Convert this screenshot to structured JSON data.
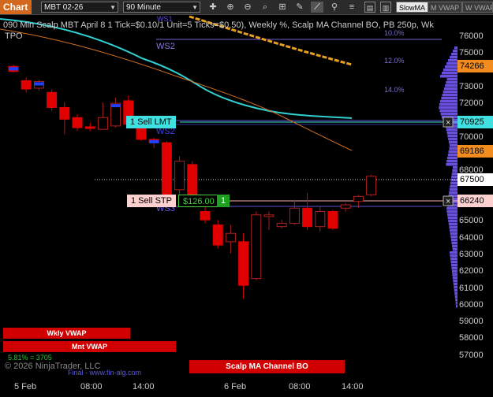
{
  "toolbar": {
    "tab": "Chart",
    "instrument": "MBT 02-26",
    "interval": "90 Minute",
    "tools": [
      "crosshair",
      "zoom-in",
      "zoom-out",
      "zoom-box",
      "properties",
      "draw",
      "indicators",
      "strategies",
      "more-1",
      "more-2",
      "more-3"
    ],
    "pill_active": "SlowMA",
    "pill_2": "M VWAP",
    "pill_3": "W VWAP"
  },
  "chart": {
    "header": "090 Min Scalp MBT April 8 1 Tick=$0.10/1 Unit=5 Ticks=$0.50), Weekly %, Scalp MA Channel BO, PB 250p, Wk",
    "tpo": "TPO",
    "ws1_top": "WS1",
    "ws2": "WS2",
    "ws2_lower": "WS2",
    "ws3": "WS3",
    "pct_10": "10.0%",
    "pct_12": "12.0%",
    "pct_14": "14.0%",
    "copyright": "© 2026 NinjaTrader, LLC",
    "small_stat": "5.81% = 3705",
    "footer_link": "Final - www.fin-alg.com"
  },
  "orders": {
    "sell_lmt": "1 Sell LMT",
    "sell_stp": "1 Sell STP",
    "pnl": "$126.00",
    "qty": "1"
  },
  "indicators": {
    "wkly_vwap": "Wkly VWAP",
    "mnt_vwap": "Mnt VWAP",
    "scalp_ma": "Scalp MA Channel BO"
  },
  "axis": {
    "y_ticks": [
      "76000",
      "75000",
      "73000",
      "72000",
      "71000",
      "70000",
      "68000",
      "65000",
      "64000",
      "63000",
      "62000",
      "61000",
      "60000",
      "59000",
      "58000",
      "57000"
    ],
    "price_tags": [
      {
        "value": "74266",
        "color": "#f28c1e"
      },
      {
        "value": "70925",
        "color": "#40e0e0"
      },
      {
        "value": "69186",
        "color": "#f28c1e"
      },
      {
        "value": "67500",
        "color": "#ffffff"
      },
      {
        "value": "66240",
        "color": "#ffd0d0"
      }
    ],
    "x_ticks": [
      "5 Feb",
      "08:00",
      "14:00",
      "6 Feb",
      "08:00",
      "14:00"
    ]
  },
  "chart_data": {
    "type": "candlestick",
    "candles": [
      {
        "o": 74250,
        "h": 74350,
        "l": 73900,
        "c": 73950
      },
      {
        "o": 73400,
        "h": 73600,
        "l": 72700,
        "c": 72900
      },
      {
        "o": 72950,
        "h": 73450,
        "l": 72800,
        "c": 73350
      },
      {
        "o": 72700,
        "h": 72900,
        "l": 71600,
        "c": 71800
      },
      {
        "o": 71800,
        "h": 72100,
        "l": 70200,
        "c": 71100
      },
      {
        "o": 71200,
        "h": 71400,
        "l": 70400,
        "c": 70600
      },
      {
        "o": 70650,
        "h": 70900,
        "l": 70400,
        "c": 70550
      },
      {
        "o": 70500,
        "h": 72100,
        "l": 70500,
        "c": 71200
      },
      {
        "o": 70700,
        "h": 72400,
        "l": 70600,
        "c": 72050
      },
      {
        "o": 72200,
        "h": 72500,
        "l": 70700,
        "c": 70800
      },
      {
        "o": 71000,
        "h": 71200,
        "l": 69800,
        "c": 69900
      },
      {
        "o": 69900,
        "h": 70000,
        "l": 69400,
        "c": 69700
      },
      {
        "o": 69700,
        "h": 69800,
        "l": 66300,
        "c": 66400
      },
      {
        "o": 66900,
        "h": 68900,
        "l": 66200,
        "c": 68600
      },
      {
        "o": 68400,
        "h": 68600,
        "l": 66100,
        "c": 66300
      },
      {
        "o": 65600,
        "h": 66200,
        "l": 64900,
        "c": 65100
      },
      {
        "o": 64800,
        "h": 65100,
        "l": 63400,
        "c": 63600
      },
      {
        "o": 63800,
        "h": 64800,
        "l": 63100,
        "c": 64300
      },
      {
        "o": 63800,
        "h": 64300,
        "l": 60400,
        "c": 61200
      },
      {
        "o": 61600,
        "h": 65600,
        "l": 61500,
        "c": 65400
      },
      {
        "o": 65300,
        "h": 65600,
        "l": 64500,
        "c": 65400
      },
      {
        "o": 64700,
        "h": 65100,
        "l": 64600,
        "c": 64900
      },
      {
        "o": 64900,
        "h": 66300,
        "l": 64800,
        "c": 65800
      },
      {
        "o": 65800,
        "h": 66700,
        "l": 64500,
        "c": 64700
      },
      {
        "o": 64700,
        "h": 65900,
        "l": 64400,
        "c": 65600
      },
      {
        "o": 65600,
        "h": 65700,
        "l": 64500,
        "c": 64600
      },
      {
        "o": 65800,
        "h": 66100,
        "l": 65600,
        "c": 66000
      },
      {
        "o": 66200,
        "h": 66600,
        "l": 65800,
        "c": 66500
      },
      {
        "o": 66600,
        "h": 67800,
        "l": 66500,
        "c": 67700
      }
    ],
    "up_color": "#000000",
    "down_color": "#e00000"
  }
}
